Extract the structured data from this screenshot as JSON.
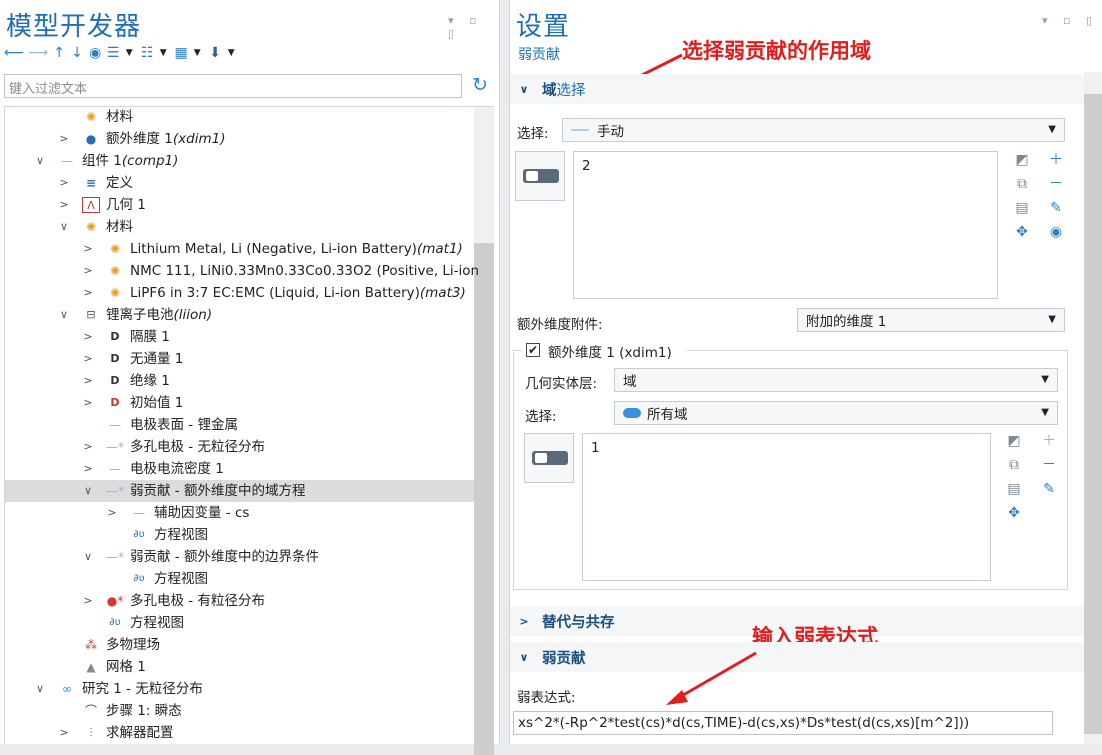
{
  "left": {
    "title": "模型开发器",
    "filter_placeholder": "键入过滤文本",
    "tree": [
      {
        "label": "材料",
        "em": ""
      },
      {
        "label": "额外维度 1 ",
        "em": "(xdim1)"
      },
      {
        "label": "组件 1 ",
        "em": "(comp1)"
      },
      {
        "label": "定义",
        "em": ""
      },
      {
        "label": "几何 1",
        "em": ""
      },
      {
        "label": "材料",
        "em": ""
      },
      {
        "label": "Lithium Metal, Li (Negative, Li-ion Battery) ",
        "em": "(mat1)"
      },
      {
        "label": "NMC 111, LiNi0.33Mn0.33Co0.33O2 (Positive, Li-ion",
        "em": ""
      },
      {
        "label": "LiPF6 in 3:7 EC:EMC (Liquid, Li-ion Battery) ",
        "em": "(mat3)"
      },
      {
        "label": "锂离子电池 ",
        "em": "(liion)"
      },
      {
        "label": "隔膜 1",
        "em": ""
      },
      {
        "label": "无通量 1",
        "em": ""
      },
      {
        "label": "绝缘 1",
        "em": ""
      },
      {
        "label": "初始值 1",
        "em": ""
      },
      {
        "label": "电极表面 - 锂金属",
        "em": ""
      },
      {
        "label": "多孔电极 - 无粒径分布",
        "em": ""
      },
      {
        "label": "电极电流密度 1",
        "em": ""
      },
      {
        "label": "弱贡献 - 额外维度中的域方程",
        "em": ""
      },
      {
        "label": "辅助因变量 - cs",
        "em": ""
      },
      {
        "label": "方程视图",
        "em": ""
      },
      {
        "label": "弱贡献 - 额外维度中的边界条件",
        "em": ""
      },
      {
        "label": "方程视图",
        "em": ""
      },
      {
        "label": "多孔电极 - 有粒径分布",
        "em": ""
      },
      {
        "label": "方程视图",
        "em": ""
      },
      {
        "label": "多物理场",
        "em": ""
      },
      {
        "label": "网格 1",
        "em": ""
      },
      {
        "label": "研究 1 - 无粒径分布",
        "em": ""
      },
      {
        "label": "步骤 1: 瞬态",
        "em": ""
      },
      {
        "label": "求解器配置",
        "em": ""
      }
    ]
  },
  "right": {
    "title": "设置",
    "subtitle": "弱贡献",
    "annotation_top": "选择弱贡献的作用域",
    "annotation_bottom": "输入弱表达式",
    "domain_section": {
      "title_prefix": "域",
      "title_rest": "选择",
      "selection_label": "选择:",
      "selection_value": "手动",
      "list_value": "2"
    },
    "xdim": {
      "attach_label": "额外维度附件:",
      "attach_value": "附加的维度 1",
      "group_label": "额外维度 1 (xdim1)",
      "checked": true,
      "geom_label": "几何实体层:",
      "geom_value": "域",
      "selection_label": "选择:",
      "selection_value": "所有域",
      "list_value": "1"
    },
    "section_alt": "替代与共存",
    "section_weak": "弱贡献",
    "weak_label": "弱表达式:",
    "weak_expr": "xs^2*(-Rp^2*test(cs)*d(cs,TIME)-d(cs,xs)*Ds*test(d(cs,xs)[m^2]))"
  }
}
